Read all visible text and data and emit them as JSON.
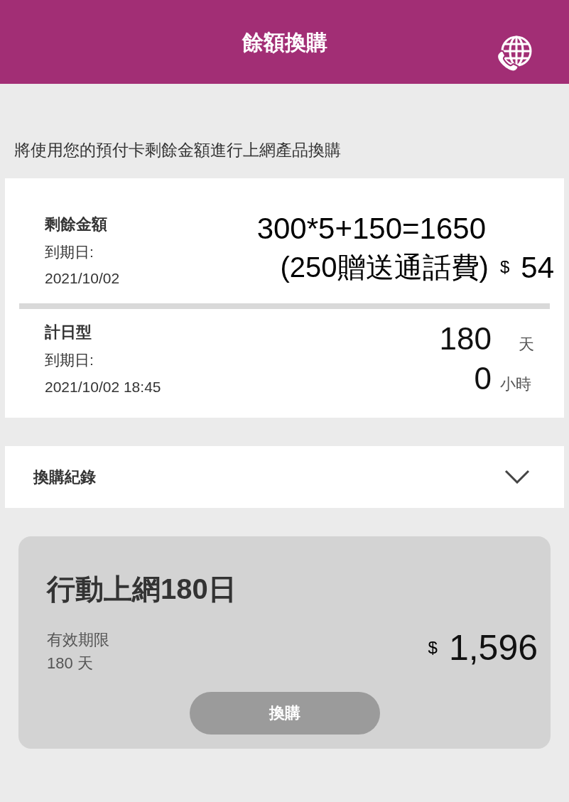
{
  "header": {
    "title": "餘額換購"
  },
  "intro": "將使用您的預付卡剩餘金額進行上網產品換購",
  "balance": {
    "label": "剩餘金額",
    "expiry_label": "到期日:",
    "expiry": "2021/10/02",
    "note_line1": "300*5+150=1650",
    "note_line2": "(250贈送通話費)",
    "currency": "$",
    "amount": "54"
  },
  "plan": {
    "label": "計日型",
    "expiry_label": "到期日:",
    "expiry": "2021/10/02 18:45",
    "days": "180",
    "days_unit": "天",
    "hours": "0",
    "hours_unit": "小時"
  },
  "history": {
    "label": "換購紀錄",
    "expanded": false
  },
  "products": [
    {
      "name": "行動上網180日",
      "validity_label": "有效期限",
      "validity": "180 天",
      "currency": "$",
      "price": "1,596",
      "button": "換購"
    }
  ]
}
